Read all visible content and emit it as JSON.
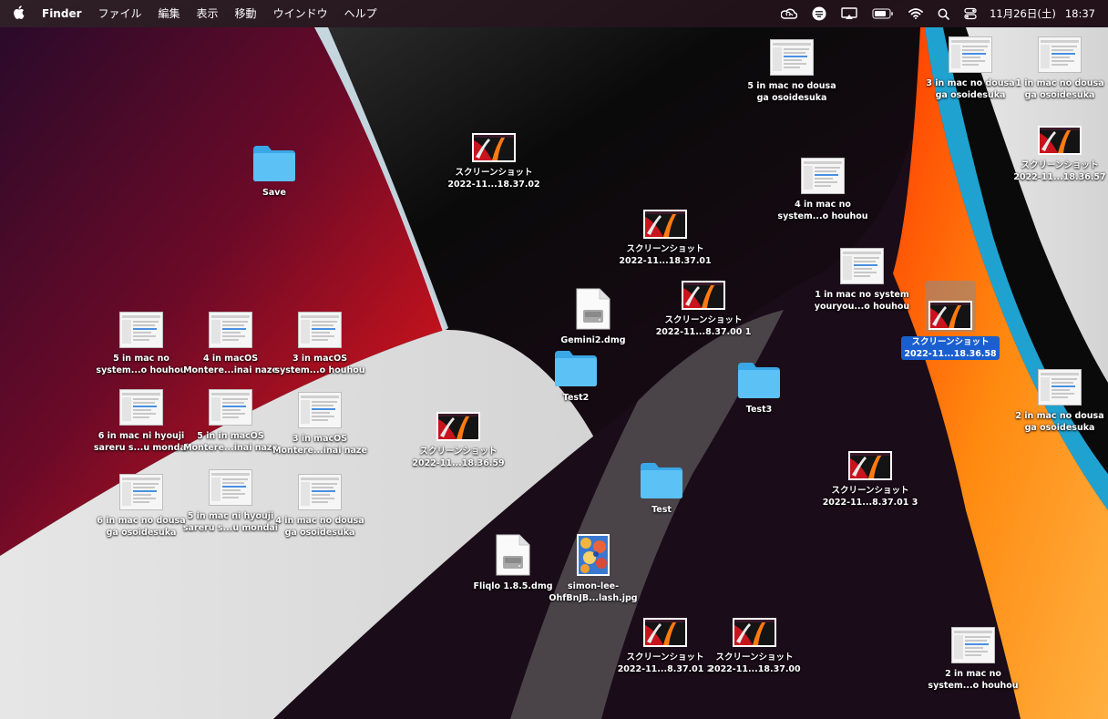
{
  "menubar": {
    "app_name": "Finder",
    "menus": [
      "ファイル",
      "編集",
      "表示",
      "移動",
      "ウインドウ",
      "ヘルプ"
    ],
    "date": "11月26日(土)",
    "time": "18:37"
  },
  "desktop_icons": [
    {
      "type": "folder",
      "label": [
        "Save"
      ]
    },
    {
      "type": "screenshot",
      "label": [
        "スクリーンショット",
        "2022-11...18.37.02"
      ]
    },
    {
      "type": "doc",
      "label": [
        "5 in mac no dousa",
        "ga osoidesuka"
      ]
    },
    {
      "type": "doc",
      "label": [
        "3 in mac no dousa",
        "ga osoidesuka"
      ]
    },
    {
      "type": "doc",
      "label": [
        "1 in mac no dousa",
        "ga osoidesuka"
      ]
    },
    {
      "type": "screenshot",
      "label": [
        "スクリーンショット",
        "2022-11...18.36.57"
      ]
    },
    {
      "type": "doc",
      "label": [
        "4 in mac no",
        "system...o houhou"
      ]
    },
    {
      "type": "screenshot",
      "label": [
        "スクリーンショット",
        "2022-11...18.37.01"
      ]
    },
    {
      "type": "doc",
      "label": [
        "1 in mac no system",
        "youryou...o houhou"
      ]
    },
    {
      "type": "dmg",
      "label": [
        "Gemini2.dmg"
      ]
    },
    {
      "type": "screenshot",
      "label": [
        "スクリーンショット",
        "2022-11...8.37.00 1"
      ]
    },
    {
      "type": "screenshot",
      "label": [
        "スクリーンショット",
        "2022-11...18.36.58"
      ],
      "selected": true
    },
    {
      "type": "doc",
      "label": [
        "5 in mac no",
        "system...o houhou"
      ]
    },
    {
      "type": "doc",
      "label": [
        "4 in macOS",
        "Montere...inai naze"
      ]
    },
    {
      "type": "doc",
      "label": [
        "3 in macOS",
        "system...o houhou"
      ]
    },
    {
      "type": "folder",
      "label": [
        "Test2"
      ]
    },
    {
      "type": "folder",
      "label": [
        "Test3"
      ]
    },
    {
      "type": "doc",
      "label": [
        "2 in mac no dousa",
        "ga osoidesuka"
      ]
    },
    {
      "type": "doc",
      "label": [
        "6 in mac ni hyouji",
        "sareru s...u mondai"
      ]
    },
    {
      "type": "doc",
      "label": [
        "5 in in macOS",
        "Montere...inai naze"
      ]
    },
    {
      "type": "doc",
      "label": [
        "3 in macOS",
        "Montere...inai naze"
      ]
    },
    {
      "type": "screenshot",
      "label": [
        "スクリーンショット",
        "2022-11...18.36.59"
      ]
    },
    {
      "type": "folder",
      "label": [
        "Test"
      ]
    },
    {
      "type": "screenshot",
      "label": [
        "スクリーンショット",
        "2022-11...8.37.01 3"
      ]
    },
    {
      "type": "doc",
      "label": [
        "6 in mac no dousa",
        "ga osoidesuka"
      ]
    },
    {
      "type": "doc",
      "label": [
        "5 in mac ni hyouji",
        "sareru s...u mondai"
      ]
    },
    {
      "type": "doc",
      "label": [
        "4 in mac no dousa",
        "ga osoidesuka"
      ]
    },
    {
      "type": "dmg",
      "label": [
        "Fliqlo 1.8.5.dmg"
      ]
    },
    {
      "type": "image",
      "label": [
        "simon-lee-",
        "OhfBnJB...lash.jpg"
      ]
    },
    {
      "type": "screenshot",
      "label": [
        "スクリーンショット",
        "2022-11...8.37.01 2"
      ]
    },
    {
      "type": "screenshot",
      "label": [
        "スクリーンショット",
        "2022-11...18.37.00"
      ]
    },
    {
      "type": "doc",
      "label": [
        "2 in mac no",
        "system...o houhou"
      ]
    }
  ]
}
